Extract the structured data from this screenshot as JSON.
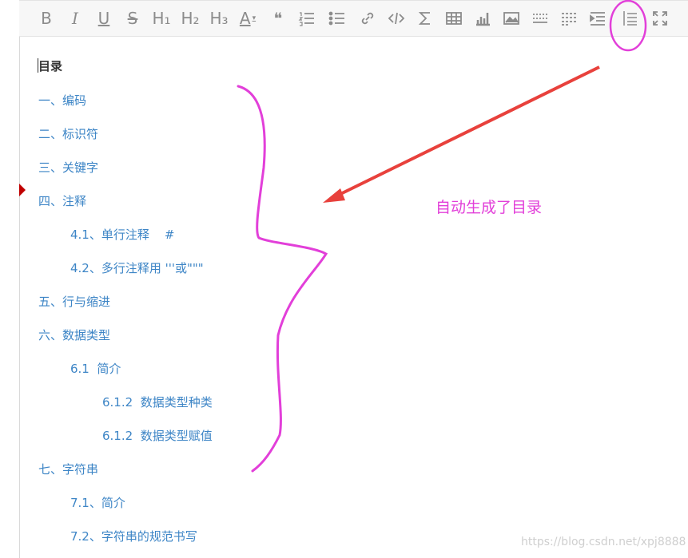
{
  "toolbar": {
    "buttons": [
      {
        "name": "bold-button",
        "glyph": "B"
      },
      {
        "name": "italic-button",
        "glyph": "I"
      },
      {
        "name": "underline-button",
        "glyph": "U"
      },
      {
        "name": "strikethrough-button",
        "glyph": "S"
      },
      {
        "name": "heading1-button",
        "glyph": "H₁"
      },
      {
        "name": "heading2-button",
        "glyph": "H₂"
      },
      {
        "name": "heading3-button",
        "glyph": "H₃"
      },
      {
        "name": "font-color-button",
        "glyph": "A"
      },
      {
        "name": "quote-button",
        "glyph": "❝"
      }
    ]
  },
  "toc": {
    "title": "目录",
    "items": [
      {
        "text": "一、编码",
        "level": 1
      },
      {
        "text": "二、标识符",
        "level": 1
      },
      {
        "text": "三、关键字",
        "level": 1
      },
      {
        "text": "四、注释",
        "level": 1
      },
      {
        "text": "4.1、单行注释    #",
        "level": 2
      },
      {
        "text": "4.2、多行注释用 '''或\"\"\"",
        "level": 2
      },
      {
        "text": "五、行与缩进",
        "level": 1
      },
      {
        "text": "六、数据类型",
        "level": 1
      },
      {
        "text": "6.1  简介",
        "level": 2
      },
      {
        "text": "6.1.2  数据类型种类",
        "level": 3
      },
      {
        "text": "6.1.2  数据类型赋值",
        "level": 3
      },
      {
        "text": "七、字符串",
        "level": 1
      },
      {
        "text": "7.1、简介",
        "level": 2
      },
      {
        "text": "7.2、字符串的规范书写",
        "level": 2
      }
    ]
  },
  "annotation": {
    "text": "自动生成了目录",
    "color": "#e23fd9"
  },
  "arrow_color": "#e8413c",
  "watermark": "https://blog.csdn.net/xpj8888",
  "colors": {
    "link": "#3d85c6",
    "icon": "#8c8c8c",
    "toolbar_bg": "#f7f7f7"
  }
}
